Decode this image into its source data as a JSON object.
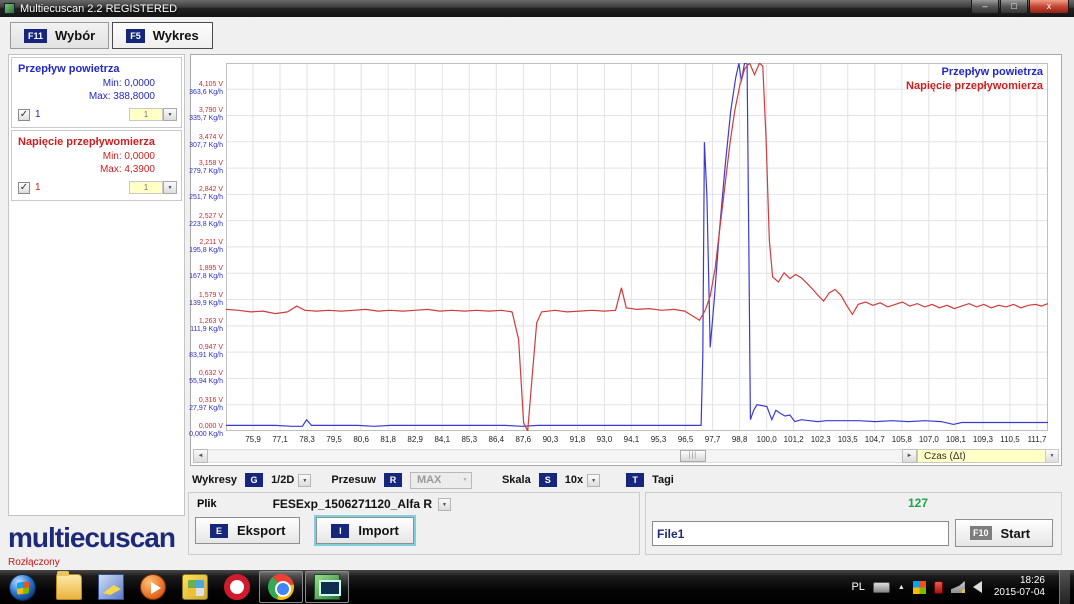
{
  "window": {
    "title": "Multiecuscan 2.2 REGISTERED"
  },
  "tabs": [
    {
      "key": "F11",
      "label": "Wybór",
      "active": false
    },
    {
      "key": "F5",
      "label": "Wykres",
      "active": true
    }
  ],
  "sidebar": {
    "series": [
      {
        "name": "Przepływ powietrza",
        "min_label": "Min: 0,0000",
        "max_label": "Max: 388,8000",
        "channel": "1",
        "combo_value": "1",
        "color": "#2328c4"
      },
      {
        "name": "Napięcie przepływomierza",
        "min_label": "Min: 0,0000",
        "max_label": "Max: 4,3900",
        "channel": "1",
        "combo_value": "1",
        "color": "#cc1f1f"
      }
    ],
    "logo": "multiecuscan"
  },
  "chart_data": {
    "type": "line",
    "legend": [
      "Przepływ powietrza",
      "Napięcie przepływomierza"
    ],
    "x_axis_label": "Czas (Δt)",
    "x_ticks": [
      "75,9",
      "77,1",
      "78,3",
      "79,5",
      "80,6",
      "81,8",
      "82,9",
      "84,1",
      "85,3",
      "86,4",
      "87,6",
      "90,3",
      "91,8",
      "93,0",
      "94,1",
      "95,3",
      "96,5",
      "97,7",
      "98,8",
      "100,0",
      "101,2",
      "102,3",
      "103,5",
      "104,7",
      "105,8",
      "107,0",
      "108,1",
      "109,3",
      "110,5",
      "111,7"
    ],
    "y_ticks": [
      {
        "value": 4.105,
        "volt": "4,105 V",
        "kgh": "363,6 Kg/h"
      },
      {
        "value": 3.79,
        "volt": "3,790 V",
        "kgh": "335,7 Kg/h"
      },
      {
        "value": 3.474,
        "volt": "3,474 V",
        "kgh": "307,7 Kg/h"
      },
      {
        "value": 3.158,
        "volt": "3,158 V",
        "kgh": "279,7 Kg/h"
      },
      {
        "value": 2.842,
        "volt": "2,842 V",
        "kgh": "251,7 Kg/h"
      },
      {
        "value": 2.527,
        "volt": "2,527 V",
        "kgh": "223,8 Kg/h"
      },
      {
        "value": 2.211,
        "volt": "2,211 V",
        "kgh": "195,8 Kg/h"
      },
      {
        "value": 1.895,
        "volt": "1,895 V",
        "kgh": "167,8 Kg/h"
      },
      {
        "value": 1.579,
        "volt": "1,579 V",
        "kgh": "139,9 Kg/h"
      },
      {
        "value": 1.263,
        "volt": "1,263 V",
        "kgh": "111,9 Kg/h"
      },
      {
        "value": 0.947,
        "volt": "0,947 V",
        "kgh": "83,91 Kg/h"
      },
      {
        "value": 0.632,
        "volt": "0,632 V",
        "kgh": "55,94 Kg/h"
      },
      {
        "value": 0.316,
        "volt": "0,316 V",
        "kgh": "27,97 Kg/h"
      },
      {
        "value": 0.0,
        "volt": "0,000 V",
        "kgh": "0,000 Kg/h"
      }
    ],
    "y_max_volt": 4.42,
    "kgh_per_volt": 88.52,
    "series": [
      {
        "name": "Przepływ powietrza",
        "unit": "Kg/h",
        "color": "#3b3bd4",
        "points": [
          [
            0,
            6
          ],
          [
            2,
            6
          ],
          [
            4,
            6
          ],
          [
            6,
            6
          ],
          [
            8,
            5
          ],
          [
            9.3,
            5
          ],
          [
            9.8,
            12
          ],
          [
            10.4,
            6
          ],
          [
            12,
            6
          ],
          [
            14,
            6
          ],
          [
            16,
            6
          ],
          [
            18,
            5
          ],
          [
            20,
            6
          ],
          [
            22,
            6
          ],
          [
            24,
            6
          ],
          [
            26,
            6
          ],
          [
            28,
            6
          ],
          [
            30,
            6
          ],
          [
            32,
            6
          ],
          [
            34,
            6
          ],
          [
            36,
            5
          ],
          [
            38,
            6
          ],
          [
            40,
            6
          ],
          [
            42,
            6
          ],
          [
            44,
            6
          ],
          [
            46,
            6
          ],
          [
            48,
            6
          ],
          [
            50,
            6
          ],
          [
            52,
            6
          ],
          [
            54,
            6
          ],
          [
            56,
            6
          ],
          [
            57.8,
            6
          ],
          [
            58.0,
            80
          ],
          [
            58.2,
            307
          ],
          [
            58.5,
            250
          ],
          [
            58.9,
            89
          ],
          [
            59.4,
            140
          ],
          [
            60.0,
            210
          ],
          [
            60.7,
            280
          ],
          [
            61.4,
            340
          ],
          [
            62.0,
            375
          ],
          [
            62.4,
            391
          ],
          [
            62.7,
            372
          ],
          [
            63.1,
            392
          ],
          [
            63.4,
            390
          ],
          [
            63.6,
            200
          ],
          [
            63.8,
            12
          ],
          [
            64.2,
            22
          ],
          [
            64.6,
            28
          ],
          [
            65.2,
            27
          ],
          [
            65.8,
            26
          ],
          [
            66.4,
            12
          ],
          [
            66.9,
            22
          ],
          [
            67.4,
            19
          ],
          [
            68.0,
            16
          ],
          [
            68.6,
            17
          ],
          [
            69.2,
            10
          ],
          [
            70,
            12
          ],
          [
            71,
            11
          ],
          [
            72,
            10
          ],
          [
            73,
            11
          ],
          [
            75,
            11
          ],
          [
            77,
            11
          ],
          [
            79,
            10
          ],
          [
            81,
            11
          ],
          [
            83,
            10
          ],
          [
            85,
            11
          ],
          [
            87,
            10
          ],
          [
            88.5,
            7
          ],
          [
            89.5,
            9
          ],
          [
            91,
            9
          ],
          [
            93,
            9
          ],
          [
            95,
            9
          ],
          [
            97,
            9
          ],
          [
            99,
            9
          ],
          [
            100,
            9
          ]
        ]
      },
      {
        "name": "Napięcie przepływomierza",
        "unit": "V",
        "color": "#d23b3b",
        "points": [
          [
            0,
            1.46
          ],
          [
            1.5,
            1.45
          ],
          [
            3,
            1.43
          ],
          [
            4.5,
            1.44
          ],
          [
            6,
            1.41
          ],
          [
            7.5,
            1.43
          ],
          [
            8.6,
            1.5
          ],
          [
            9.6,
            1.45
          ],
          [
            11,
            1.44
          ],
          [
            12.5,
            1.45
          ],
          [
            14,
            1.44
          ],
          [
            15.5,
            1.45
          ],
          [
            17,
            1.46
          ],
          [
            18.5,
            1.44
          ],
          [
            20,
            1.45
          ],
          [
            21.5,
            1.44
          ],
          [
            23,
            1.45
          ],
          [
            24.5,
            1.46
          ],
          [
            26,
            1.44
          ],
          [
            27.5,
            1.45
          ],
          [
            29,
            1.44
          ],
          [
            30.5,
            1.45
          ],
          [
            32,
            1.44
          ],
          [
            33.5,
            1.45
          ],
          [
            34.8,
            1.43
          ],
          [
            35.6,
            1.1
          ],
          [
            36.2,
            0.1
          ],
          [
            36.7,
            0.0
          ],
          [
            37.2,
            0.6
          ],
          [
            37.8,
            1.3
          ],
          [
            38.4,
            1.43
          ],
          [
            40,
            1.45
          ],
          [
            41.5,
            1.43
          ],
          [
            43,
            1.44
          ],
          [
            44.5,
            1.45
          ],
          [
            46,
            1.44
          ],
          [
            47.4,
            1.45
          ],
          [
            48.1,
            1.72
          ],
          [
            48.7,
            1.48
          ],
          [
            50,
            1.46
          ],
          [
            51.5,
            1.47
          ],
          [
            53,
            1.45
          ],
          [
            54.5,
            1.46
          ],
          [
            55.8,
            1.44
          ],
          [
            56.8,
            1.38
          ],
          [
            57.6,
            1.33
          ],
          [
            58.3,
            1.45
          ],
          [
            58.9,
            1.62
          ],
          [
            59.5,
            1.95
          ],
          [
            60.1,
            2.45
          ],
          [
            60.7,
            2.95
          ],
          [
            61.3,
            3.45
          ],
          [
            61.9,
            3.85
          ],
          [
            62.5,
            4.15
          ],
          [
            63.1,
            4.35
          ],
          [
            63.7,
            4.42
          ],
          [
            64.3,
            4.28
          ],
          [
            64.9,
            4.42
          ],
          [
            65.3,
            4.38
          ],
          [
            65.7,
            3.5
          ],
          [
            66.1,
            2.3
          ],
          [
            66.5,
            1.85
          ],
          [
            67.2,
            1.79
          ],
          [
            67.9,
            1.9
          ],
          [
            68.6,
            1.83
          ],
          [
            69.3,
            1.88
          ],
          [
            70.0,
            1.84
          ],
          [
            70.7,
            1.77
          ],
          [
            71.4,
            1.7
          ],
          [
            72.1,
            1.62
          ],
          [
            72.7,
            1.56
          ],
          [
            73.4,
            1.66
          ],
          [
            74.1,
            1.7
          ],
          [
            74.8,
            1.63
          ],
          [
            75.5,
            1.51
          ],
          [
            76.2,
            1.4
          ],
          [
            76.9,
            1.52
          ],
          [
            77.8,
            1.55
          ],
          [
            78.7,
            1.51
          ],
          [
            79.6,
            1.54
          ],
          [
            80.5,
            1.49
          ],
          [
            81.4,
            1.52
          ],
          [
            82.3,
            1.55
          ],
          [
            83.2,
            1.5
          ],
          [
            84.1,
            1.53
          ],
          [
            85.0,
            1.49
          ],
          [
            85.9,
            1.52
          ],
          [
            86.8,
            1.48
          ],
          [
            87.7,
            1.51
          ],
          [
            88.6,
            1.47
          ],
          [
            89.5,
            1.5
          ],
          [
            90.4,
            1.53
          ],
          [
            91.3,
            1.49
          ],
          [
            92.2,
            1.52
          ],
          [
            93.1,
            1.48
          ],
          [
            94.0,
            1.51
          ],
          [
            94.9,
            1.49
          ],
          [
            95.8,
            1.52
          ],
          [
            96.7,
            1.48
          ],
          [
            97.6,
            1.51
          ],
          [
            98.5,
            1.52
          ],
          [
            99.2,
            1.5
          ],
          [
            100,
            1.53
          ]
        ]
      }
    ],
    "grid": true,
    "legend_position": "top-right"
  },
  "scrollbar": {
    "thumb_grip": "|||"
  },
  "controls": {
    "wykresy_label": "Wykresy",
    "wykresy_key": "G",
    "wykresy_value": "1/2D",
    "przesuw_label": "Przesuw",
    "przesuw_key": "R",
    "przesuw_value": "MAX",
    "skala_label": "Skala",
    "skala_key": "S",
    "skala_value": "10x",
    "tagi_key": "T",
    "tagi_label": "Tagi"
  },
  "file_panel": {
    "plik_label": "Plik",
    "file_combo": "FESExp_1506271120_Alfa R",
    "eksport_key": "E",
    "eksport_label": "Eksport",
    "import_key": "I",
    "import_label": "Import",
    "counter": "127",
    "file_field_value": "File1",
    "start_key": "F10",
    "start_label": "Start"
  },
  "status": {
    "text": "Rozłączony"
  },
  "taskbar": {
    "lang": "PL",
    "time": "18:26",
    "date": "2015-07-04",
    "icons": [
      "start-orb",
      "explorer-icon",
      "graphics-app-icon",
      "media-player-icon",
      "utility-app-icon",
      "opera-icon",
      "chrome-icon",
      "multiecuscan-taskbar-icon"
    ],
    "tray_icons": [
      "keyboard-icon",
      "hidden-icons-chevron",
      "windows-flag-icon",
      "power-icon",
      "network-icon",
      "volume-icon"
    ]
  },
  "colors": {
    "accent_badge": "#15267c",
    "series_blue": "#3b3bd4",
    "series_red": "#d23b3b",
    "counter_green": "#1fa349",
    "highlight_yellow": "#ffffc6"
  }
}
